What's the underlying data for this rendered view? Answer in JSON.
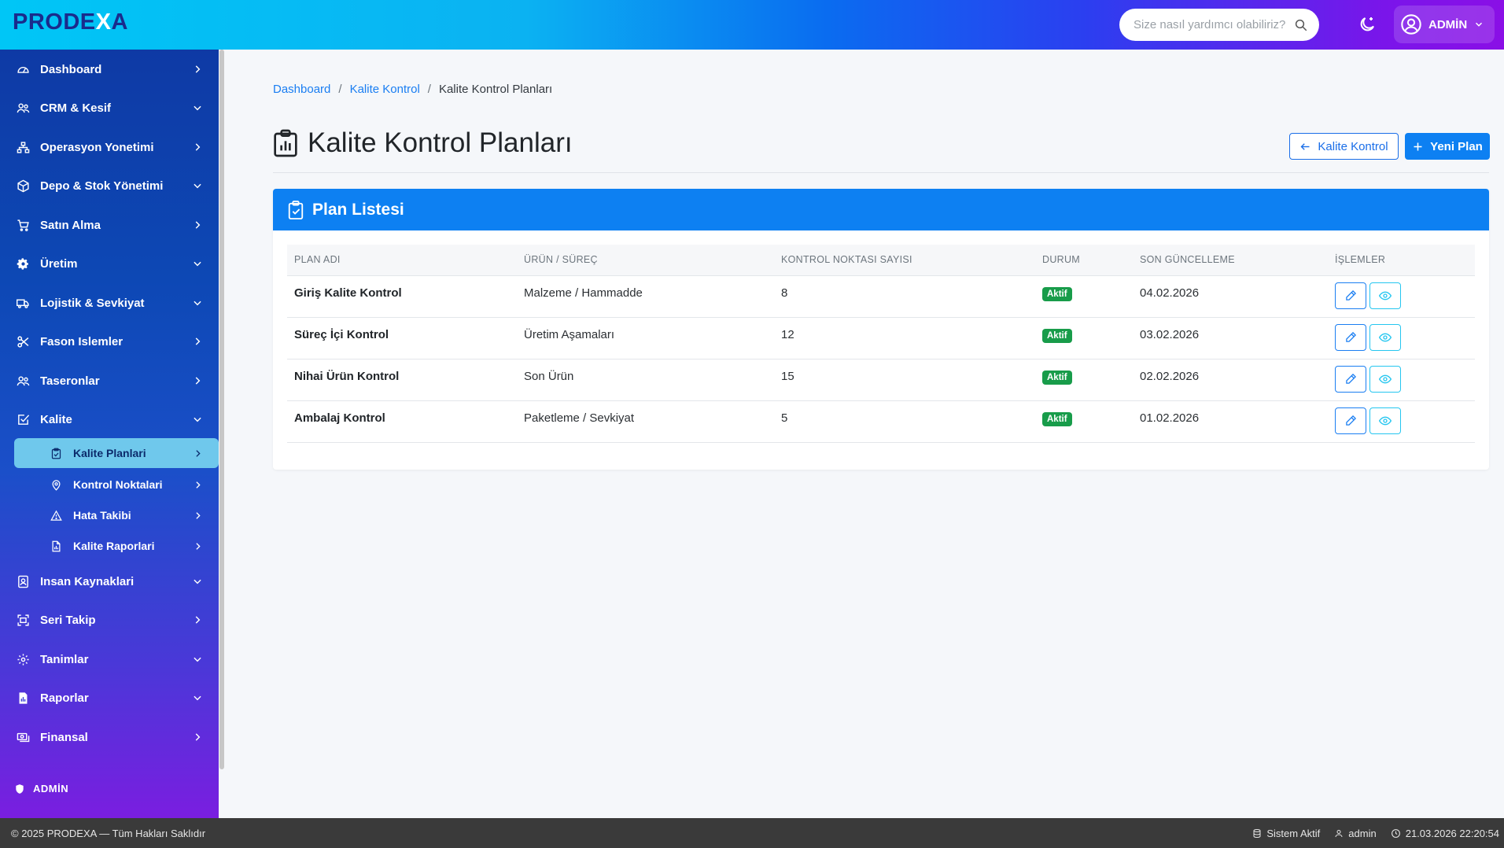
{
  "brand": {
    "logo_a": "PRODE",
    "logo_x": "X",
    "logo_b": "A"
  },
  "search": {
    "placeholder": "Size nasıl yardımcı olabiliriz?"
  },
  "user": {
    "name": "ADMİN"
  },
  "sidebar": {
    "items": [
      {
        "label": "Dashboard",
        "icon": "gauge-icon",
        "chevron": "right"
      },
      {
        "label": "CRM & Kesif",
        "icon": "users-icon",
        "chevron": "down"
      },
      {
        "label": "Operasyon Yonetimi",
        "icon": "sitemap-icon",
        "chevron": "right"
      },
      {
        "label": "Depo & Stok Yönetimi",
        "icon": "box-icon",
        "chevron": "down"
      },
      {
        "label": "Satın Alma",
        "icon": "cart-icon",
        "chevron": "right"
      },
      {
        "label": "Üretim",
        "icon": "gear-icon",
        "chevron": "down"
      },
      {
        "label": "Lojistik & Sevkiyat",
        "icon": "truck-icon",
        "chevron": "down"
      },
      {
        "label": "Fason Islemler",
        "icon": "scissors-icon",
        "chevron": "right"
      },
      {
        "label": "Taseronlar",
        "icon": "users-icon",
        "chevron": "right"
      },
      {
        "label": "Kalite",
        "icon": "check-square-icon",
        "chevron": "down"
      },
      {
        "label": "Insan Kaynaklari",
        "icon": "id-badge-icon",
        "chevron": "down"
      },
      {
        "label": "Seri Takip",
        "icon": "scan-icon",
        "chevron": "right"
      },
      {
        "label": "Tanimlar",
        "icon": "cog-icon",
        "chevron": "down"
      },
      {
        "label": "Raporlar",
        "icon": "report-icon",
        "chevron": "down"
      },
      {
        "label": "Finansal",
        "icon": "cash-icon",
        "chevron": "right"
      }
    ],
    "sub_items": [
      {
        "label": "Kalite Planlari",
        "icon": "clipboard-check-icon",
        "active": true
      },
      {
        "label": "Kontrol Noktalari",
        "icon": "map-pin-icon",
        "active": false
      },
      {
        "label": "Hata Takibi",
        "icon": "warning-icon",
        "active": false
      },
      {
        "label": "Kalite Raporlari",
        "icon": "file-chart-icon",
        "active": false
      }
    ],
    "footer_label": "ADMİN"
  },
  "breadcrumb": {
    "items": [
      "Dashboard",
      "Kalite Kontrol"
    ],
    "current": "Kalite Kontrol Planları",
    "separator": "/"
  },
  "page": {
    "title": "Kalite Kontrol Planları",
    "back_button": "Kalite Kontrol",
    "new_button": "Yeni Plan"
  },
  "card": {
    "title": "Plan Listesi",
    "columns": [
      "PLAN ADI",
      "ÜRÜN / SÜREÇ",
      "KONTROL NOKTASI SAYISI",
      "DURUM",
      "SON GÜNCELLEME",
      "İŞLEMLER"
    ],
    "rows": [
      {
        "name": "Giriş Kalite Kontrol",
        "process": "Malzeme / Hammadde",
        "count": "8",
        "status": "Aktif",
        "updated": "04.02.2026"
      },
      {
        "name": "Süreç İçi Kontrol",
        "process": "Üretim Aşamaları",
        "count": "12",
        "status": "Aktif",
        "updated": "03.02.2026"
      },
      {
        "name": "Nihai Ürün Kontrol",
        "process": "Son Ürün",
        "count": "15",
        "status": "Aktif",
        "updated": "02.02.2026"
      },
      {
        "name": "Ambalaj Kontrol",
        "process": "Paketleme / Sevkiyat",
        "count": "5",
        "status": "Aktif",
        "updated": "01.02.2026"
      }
    ]
  },
  "footer": {
    "copyright": "© 2025 PRODEXA — Tüm Hakları Saklıdır",
    "system_status": "Sistem Aktif",
    "user": "admin",
    "datetime": "21.03.2026 22:20:54"
  },
  "colors": {
    "primary": "#0d80f2",
    "success": "#189c4a",
    "sidebar_active": "#6fc8ec"
  }
}
